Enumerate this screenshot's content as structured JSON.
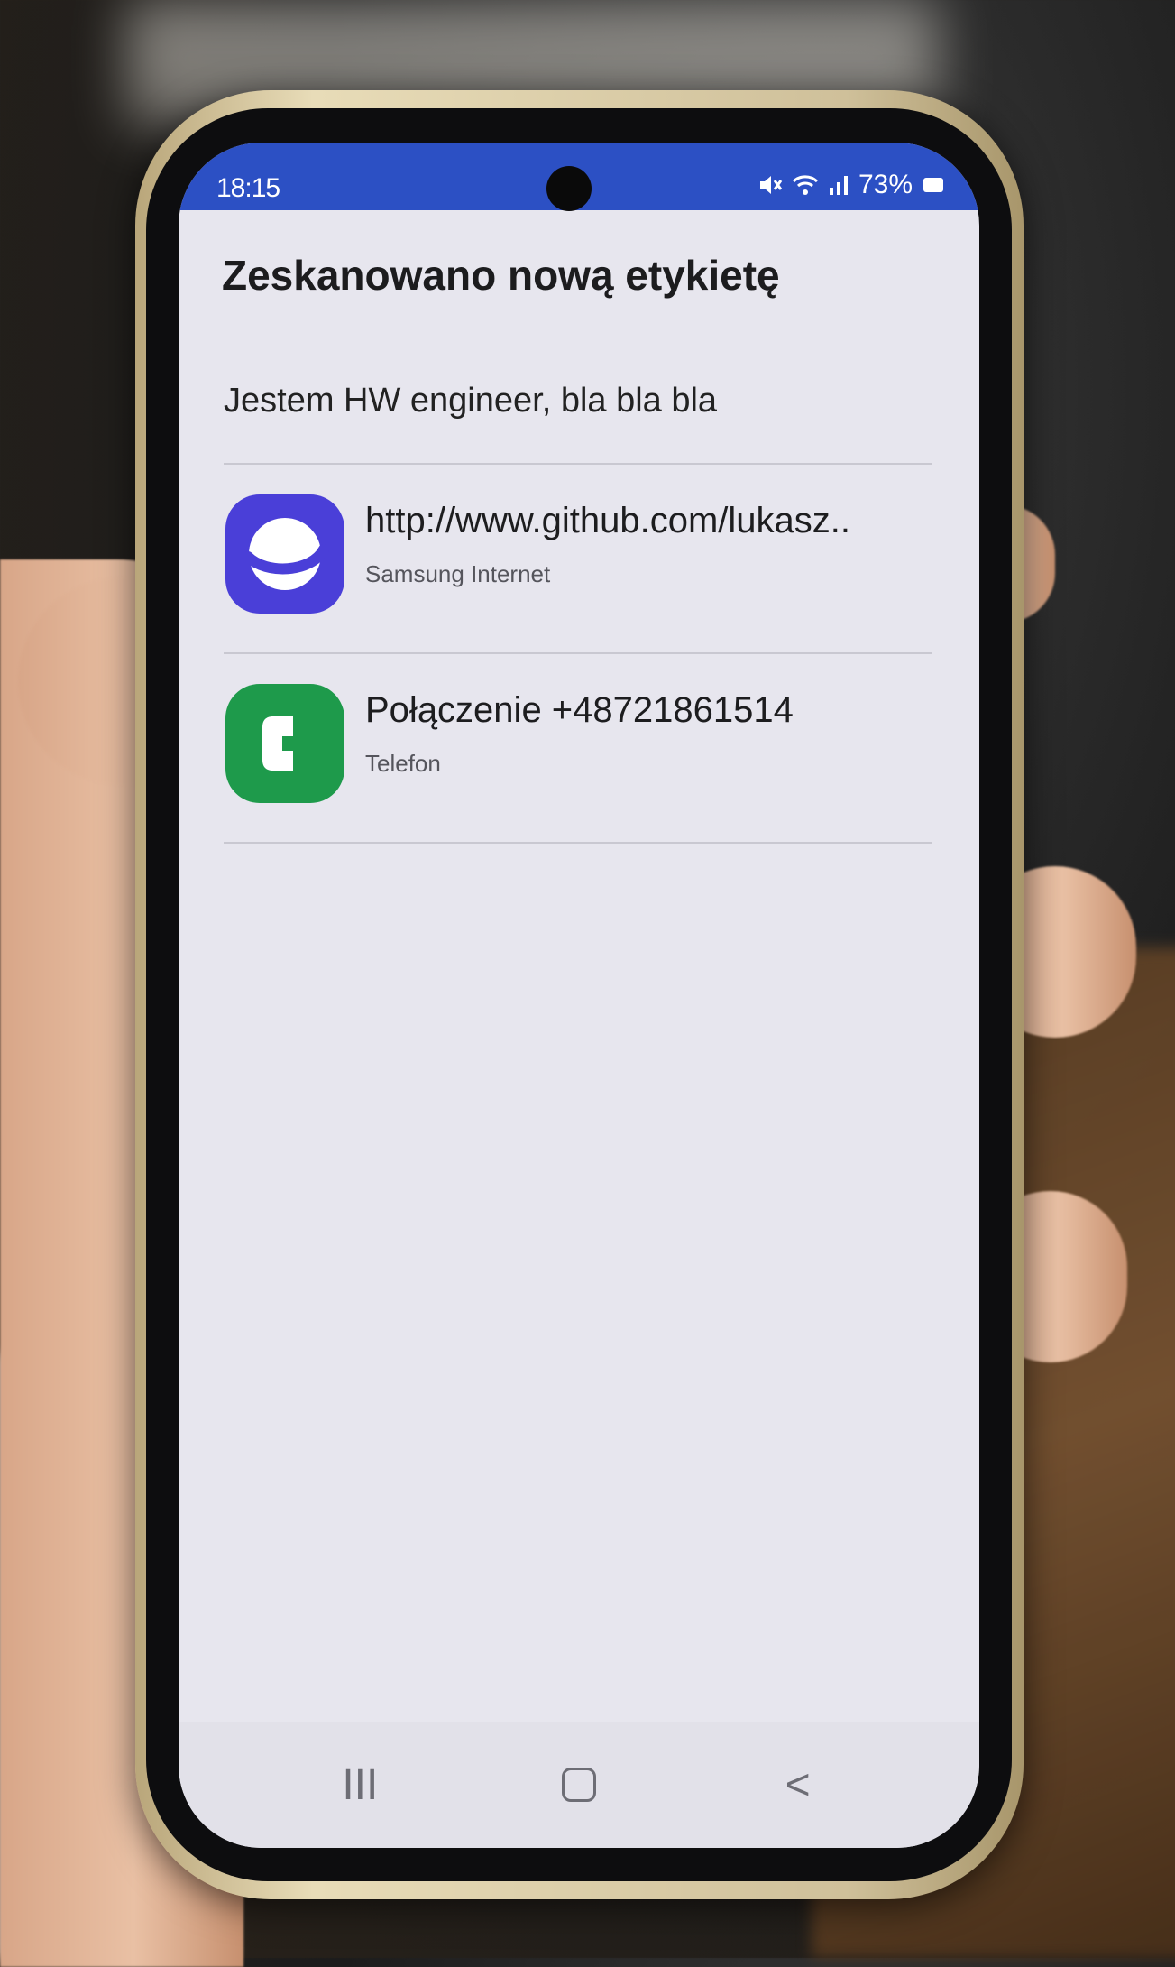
{
  "status_bar": {
    "time": "18:15",
    "battery": "73%",
    "icons": [
      "mute-icon",
      "wifi-icon",
      "signal-icon",
      "battery-icon"
    ]
  },
  "dialog": {
    "title": "Zeskanowano nową etykietę",
    "message": "Jestem HW engineer, bla bla bla",
    "actions": [
      {
        "title": "http://www.github.com/lukasz..",
        "app": "Samsung Internet",
        "icon": "samsung-internet-icon",
        "color": "#4a3fd8"
      },
      {
        "title": "Połączenie +48721861514",
        "app": "Telefon",
        "icon": "phone-icon",
        "color": "#1e9a4b"
      }
    ]
  },
  "nav_bar": {
    "recents_label": "III",
    "back_label": "<",
    "icons": [
      "recents-icon",
      "home-icon",
      "back-icon"
    ]
  },
  "colors": {
    "status_bar": "#2c50c4",
    "screen_bg": "#e7e6ee"
  }
}
